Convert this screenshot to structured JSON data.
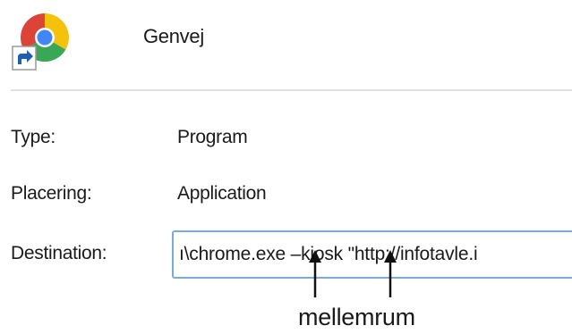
{
  "header": {
    "icon": "chrome-shortcut-icon",
    "name": "Genvej"
  },
  "properties": {
    "type_label": "Type:",
    "type_value": "Program",
    "location_label": "Placering:",
    "location_value": "Application",
    "target_label": "Destination:",
    "target_value": "ı\\chrome.exe –kiosk \"http://infotavle.i"
  },
  "annotation": {
    "text": "mellemrum"
  },
  "colors": {
    "field_border": "#7aaad6",
    "divider": "#dfdfdf",
    "chrome_red": "#db4437",
    "chrome_green": "#3aa757",
    "chrome_yellow": "#f4c20d",
    "chrome_blue": "#4285f4"
  }
}
